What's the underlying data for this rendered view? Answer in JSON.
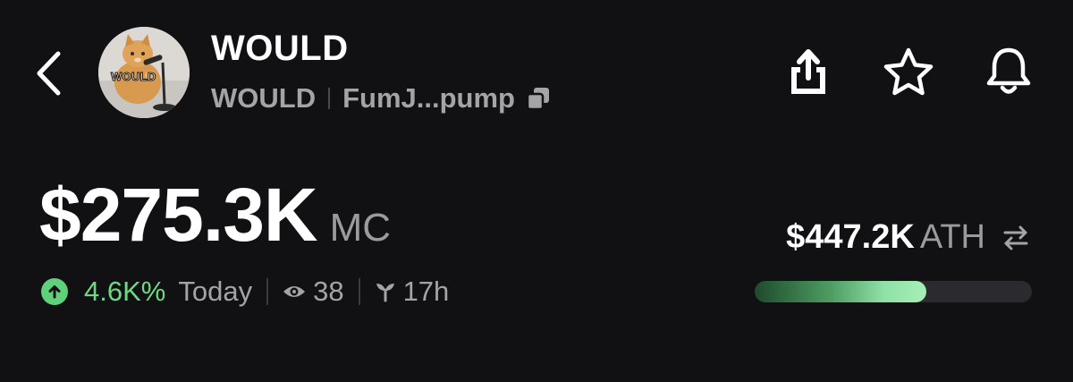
{
  "header": {
    "back_icon": "chevron-left-icon",
    "avatar_text": "WOULD",
    "token_name": "WOULD",
    "ticker": "WOULD",
    "address_short": "FumJ...pump",
    "copy_icon": "copy-icon",
    "actions": [
      {
        "icon": "share-icon"
      },
      {
        "icon": "star-icon"
      },
      {
        "icon": "bell-icon"
      }
    ]
  },
  "market": {
    "market_cap": "$275.3K",
    "market_cap_label": "MC",
    "change_icon": "arrow-up-icon",
    "change_pct": "4.6K%",
    "change_period": "Today",
    "viewers_icon": "eye-icon",
    "viewers": "38",
    "age_icon": "sprout-icon",
    "age": "17h"
  },
  "ath": {
    "value": "$447.2K",
    "label": "ATH",
    "swap_icon": "swap-arrows-icon",
    "progress_fraction": 0.62
  },
  "colors": {
    "background": "#111013",
    "positive": "#6fd882",
    "muted": "#a3a3a8"
  }
}
